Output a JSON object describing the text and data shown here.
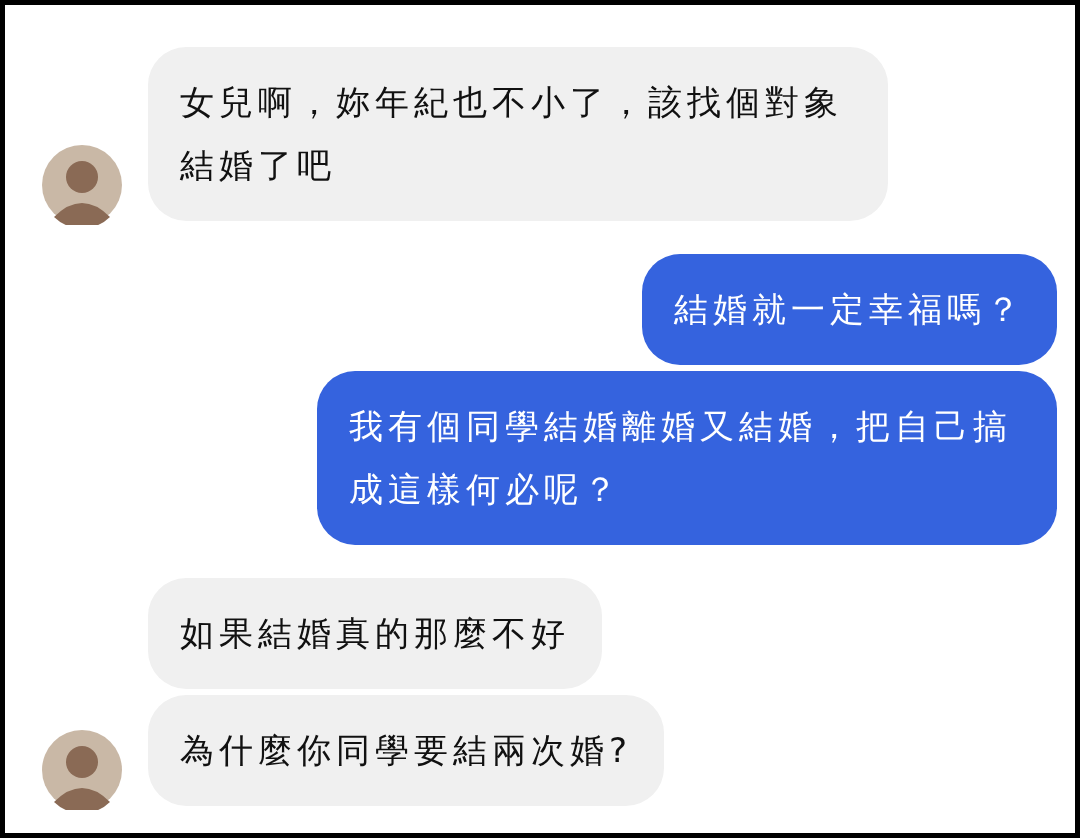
{
  "messages": [
    {
      "kind": "incoming",
      "text": "女兒啊，妳年紀也不小了，該找個對象結婚了吧"
    },
    {
      "kind": "outgoing",
      "text": "結婚就一定幸福嗎？"
    },
    {
      "kind": "outgoing",
      "text": "我有個同學結婚離婚又結婚，把自己搞成這樣何必呢？"
    },
    {
      "kind": "incoming",
      "text": "如果結婚真的那麼不好"
    },
    {
      "kind": "incoming",
      "text": "為什麼你同學要結兩次婚?"
    }
  ]
}
